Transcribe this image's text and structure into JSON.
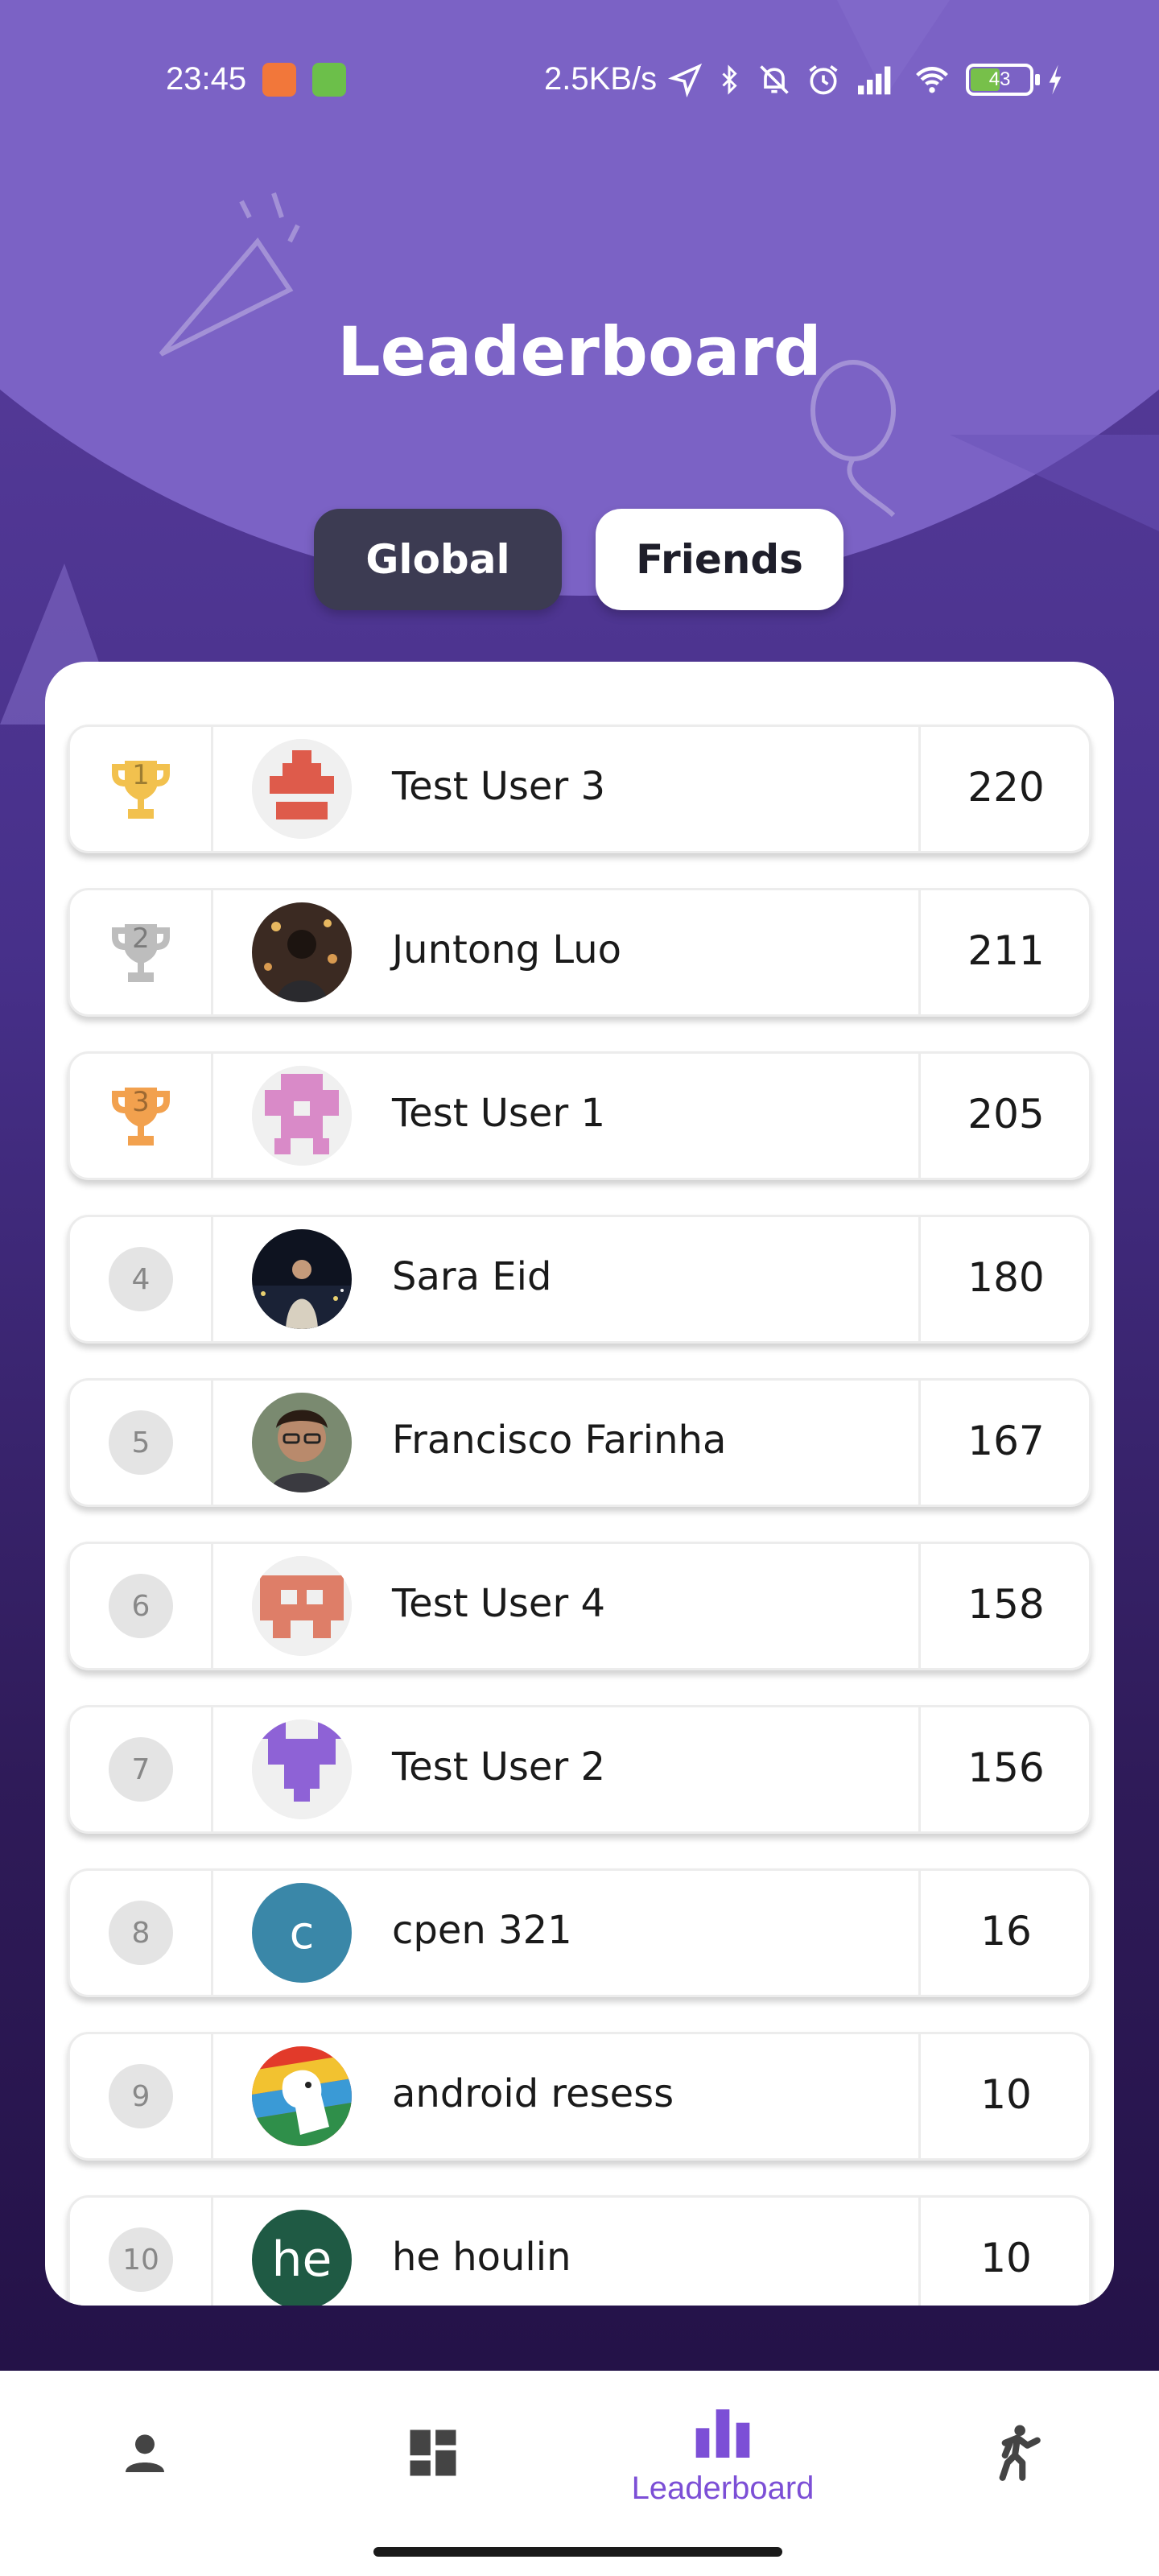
{
  "status_bar": {
    "time": "23:45",
    "network_speed": "2.5KB/s",
    "battery_level": "43",
    "icons": [
      "video-app-icon",
      "android-app-icon",
      "location-icon",
      "bluetooth-icon",
      "mute-icon",
      "alarm-icon",
      "signal-icon",
      "wifi-icon",
      "battery-icon",
      "charging-icon"
    ]
  },
  "header": {
    "title": "Leaderboard"
  },
  "tabs": [
    {
      "label": "Global",
      "selected": true
    },
    {
      "label": "Friends",
      "selected": false
    }
  ],
  "leaderboard": {
    "rows": [
      {
        "rank": "1",
        "name": "Test User 3",
        "score": "220",
        "trophy": "gold"
      },
      {
        "rank": "2",
        "name": "Juntong Luo",
        "score": "211",
        "trophy": "silver"
      },
      {
        "rank": "3",
        "name": "Test User 1",
        "score": "205",
        "trophy": "bronze"
      },
      {
        "rank": "4",
        "name": "Sara Eid",
        "score": "180"
      },
      {
        "rank": "5",
        "name": "Francisco Farinha",
        "score": "167"
      },
      {
        "rank": "6",
        "name": "Test User 4",
        "score": "158"
      },
      {
        "rank": "7",
        "name": "Test User 2",
        "score": "156"
      },
      {
        "rank": "8",
        "name": "cpen 321",
        "score": "16",
        "avatar_letter": "c"
      },
      {
        "rank": "9",
        "name": "android resess",
        "score": "10"
      },
      {
        "rank": "10",
        "name": "he houlin",
        "score": "10",
        "avatar_letter": "he"
      }
    ]
  },
  "bottom_nav": {
    "items": [
      {
        "icon": "person-icon",
        "label": ""
      },
      {
        "icon": "dashboard-icon",
        "label": ""
      },
      {
        "icon": "leaderboard-icon",
        "label": "Leaderboard",
        "active": true
      },
      {
        "icon": "activity-icon",
        "label": ""
      }
    ]
  },
  "colors": {
    "accent": "#7c4fd6",
    "gold": "#f2c14e",
    "silver": "#bdbdbd",
    "bronze": "#f2a14e"
  }
}
